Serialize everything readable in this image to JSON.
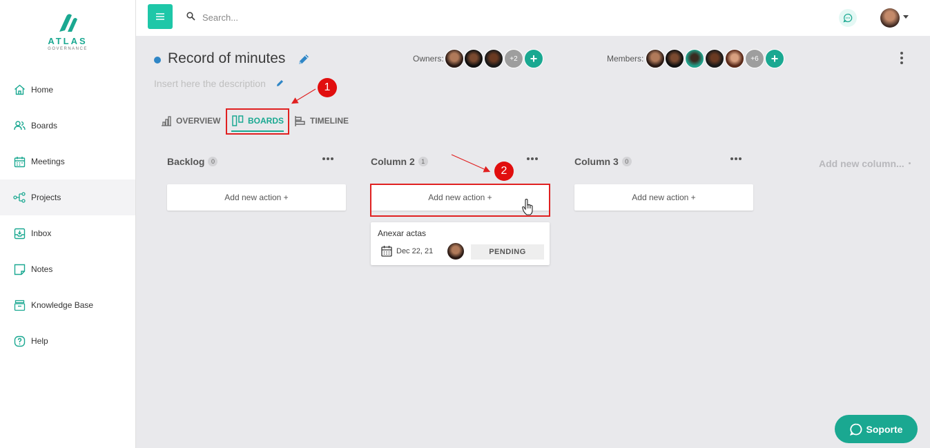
{
  "app": {
    "logo_text": "ATLAS",
    "logo_subtext": "GOVERNANCE",
    "brand_color": "#1aa891"
  },
  "sidebar": {
    "items": [
      {
        "label": "Home",
        "icon": "home-icon"
      },
      {
        "label": "Boards",
        "icon": "users-icon"
      },
      {
        "label": "Meetings",
        "icon": "calendar-icon"
      },
      {
        "label": "Projects",
        "icon": "project-tree-icon",
        "active": true
      },
      {
        "label": "Inbox",
        "icon": "inbox-icon"
      },
      {
        "label": "Notes",
        "icon": "note-icon"
      },
      {
        "label": "Knowledge Base",
        "icon": "archive-icon"
      },
      {
        "label": "Help",
        "icon": "help-icon"
      }
    ]
  },
  "topbar": {
    "search_placeholder": "Search..."
  },
  "project": {
    "title": "Record of minutes",
    "description_placeholder": "Insert here the description",
    "status_color": "#2f86c6",
    "owners_label": "Owners:",
    "owners_more": "+2",
    "members_label": "Members:",
    "members_more": "+6"
  },
  "tabs": [
    {
      "label": "OVERVIEW",
      "icon": "chart-icon"
    },
    {
      "label": "BOARDS",
      "icon": "board-columns-icon",
      "active": true
    },
    {
      "label": "TIMELINE",
      "icon": "timeline-icon"
    }
  ],
  "annotations": {
    "step1": "1",
    "step2": "2"
  },
  "board": {
    "columns": [
      {
        "title": "Backlog",
        "count": "0",
        "add_label": "Add new action +"
      },
      {
        "title": "Column 2",
        "count": "1",
        "add_label": "Add new action +"
      },
      {
        "title": "Column 3",
        "count": "0",
        "add_label": "Add new action +"
      }
    ],
    "add_column_label": "Add new column...",
    "card": {
      "title": "Anexar actas",
      "date": "Dec 22, 21",
      "status": "PENDING"
    }
  },
  "support": {
    "label": "Soporte"
  }
}
